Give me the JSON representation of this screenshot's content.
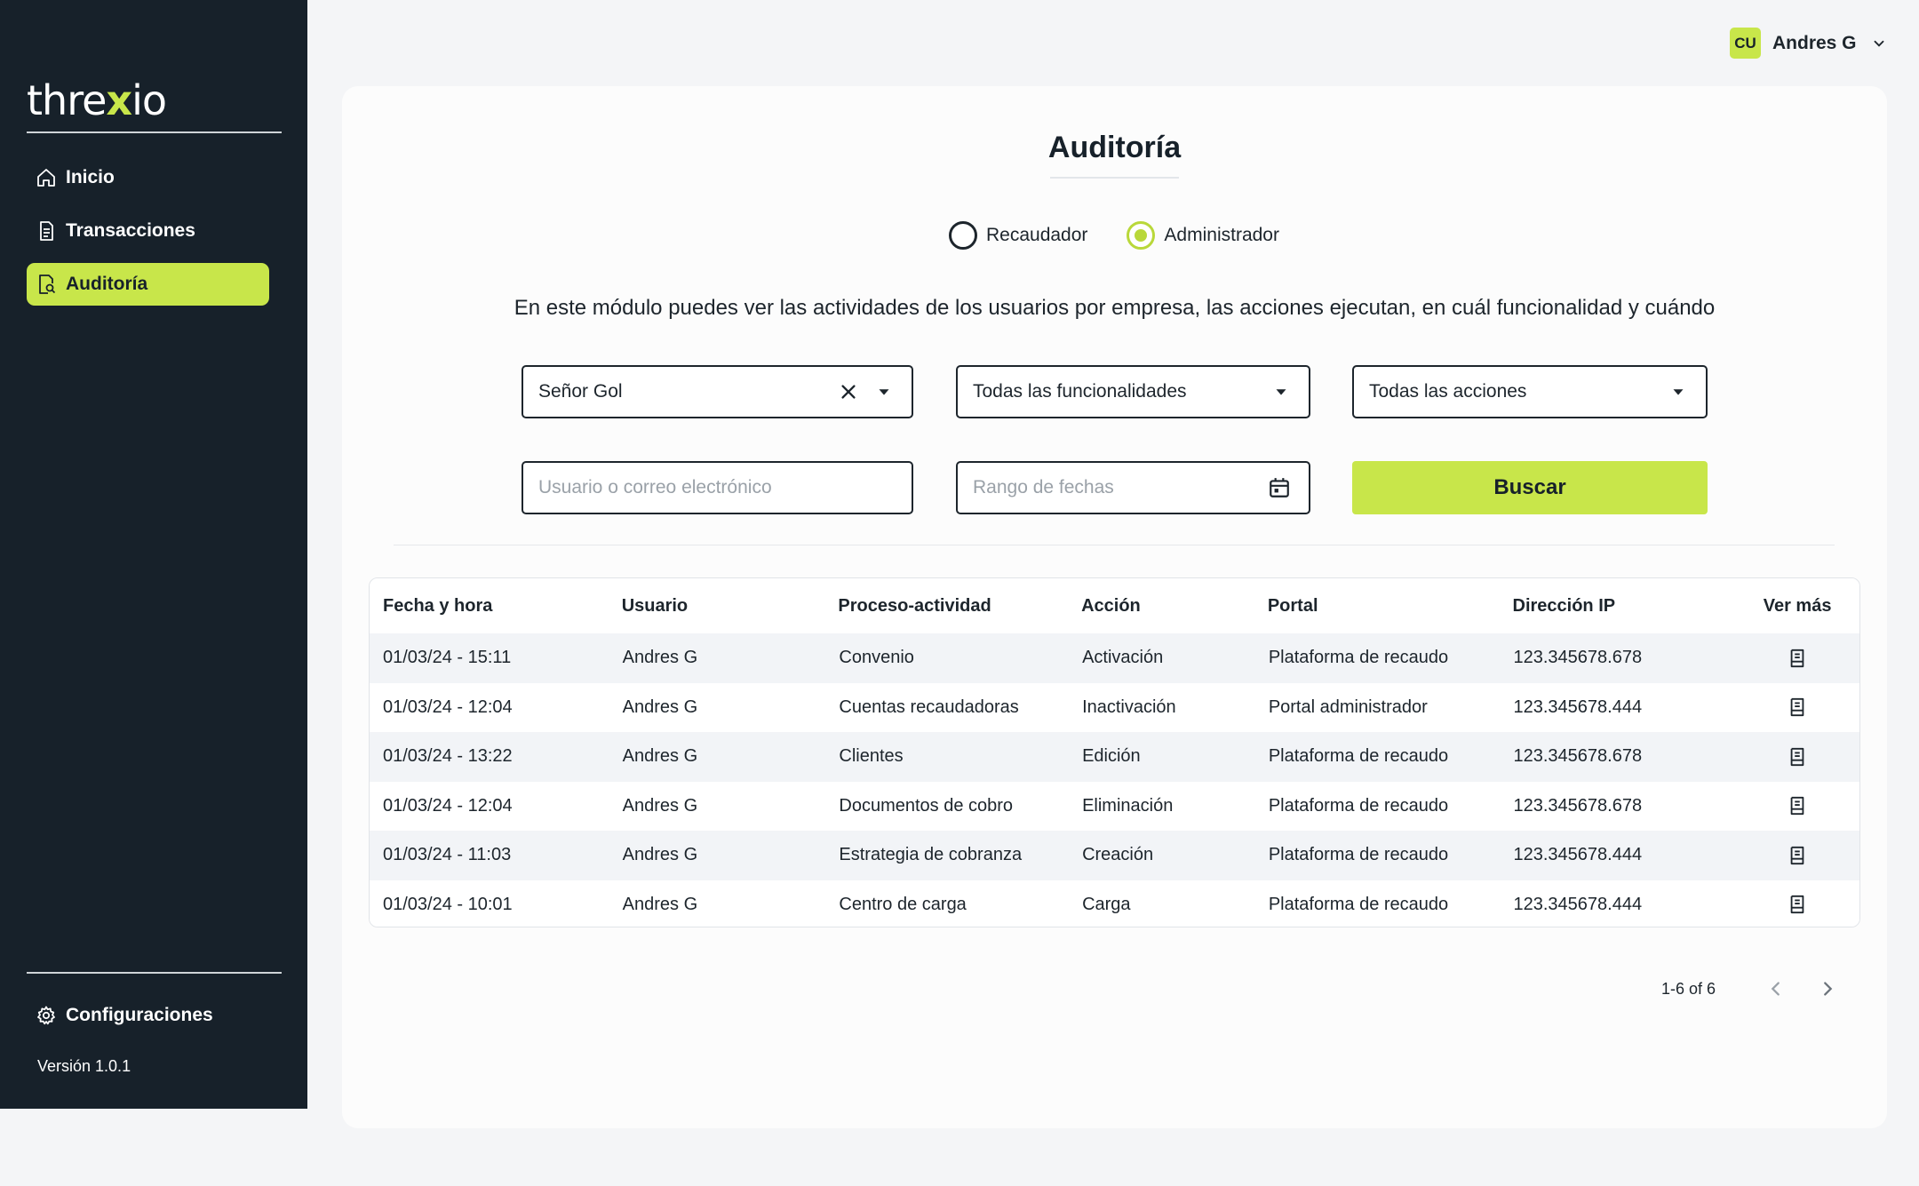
{
  "brand": {
    "logo_pre": "thre",
    "logo_x": "x",
    "logo_post": "io"
  },
  "sidebar": {
    "items": [
      {
        "label": "Inicio",
        "icon": "home-icon"
      },
      {
        "label": "Transacciones",
        "icon": "document-icon"
      },
      {
        "label": "Auditoría",
        "icon": "audit-icon",
        "active": true
      }
    ],
    "config_label": "Configuraciones",
    "version": "Versión 1.0.1"
  },
  "user": {
    "initials": "CU",
    "name": "Andres G"
  },
  "page": {
    "title": "Auditoría",
    "radio_options": [
      {
        "label": "Recaudador",
        "selected": false
      },
      {
        "label": "Administrador",
        "selected": true
      }
    ],
    "description": "En este módulo puedes ver las actividades de los usuarios por empresa, las acciones ejecutan, en cuál funcionalidad y cuándo"
  },
  "filters": {
    "empresa_value": "Señor Gol",
    "funcionalidad_value": "Todas las funcionalidades",
    "acciones_value": "Todas las acciones",
    "usuario_placeholder": "Usuario o correo electrónico",
    "fechas_placeholder": "Rango de fechas",
    "search_label": "Buscar"
  },
  "table": {
    "headers": [
      "Fecha y hora",
      "Usuario",
      "Proceso-actividad",
      "Acción",
      "Portal",
      "Dirección IP",
      "Ver más"
    ],
    "rows": [
      [
        "01/03/24 - 15:11",
        "Andres G",
        "Convenio",
        "Activación",
        "Plataforma de recaudo",
        "123.345678.678"
      ],
      [
        "01/03/24 - 12:04",
        "Andres G",
        "Cuentas recaudadoras",
        "Inactivación",
        "Portal administrador",
        "123.345678.444"
      ],
      [
        "01/03/24 - 13:22",
        "Andres G",
        "Clientes",
        "Edición",
        "Plataforma de recaudo",
        "123.345678.678"
      ],
      [
        "01/03/24 - 12:04",
        "Andres G",
        "Documentos de cobro",
        "Eliminación",
        "Plataforma de recaudo",
        "123.345678.678"
      ],
      [
        "01/03/24 - 11:03",
        "Andres G",
        "Estrategia de cobranza",
        "Creación",
        "Plataforma de recaudo",
        "123.345678.444"
      ],
      [
        "01/03/24 - 10:01",
        "Andres G",
        "Centro de carga",
        "Carga",
        "Plataforma de recaudo",
        "123.345678.444"
      ]
    ]
  },
  "pagination": {
    "range": "1-6 of 6"
  },
  "colors": {
    "accent": "#c8e64a",
    "sidebar_bg": "#17212a"
  }
}
